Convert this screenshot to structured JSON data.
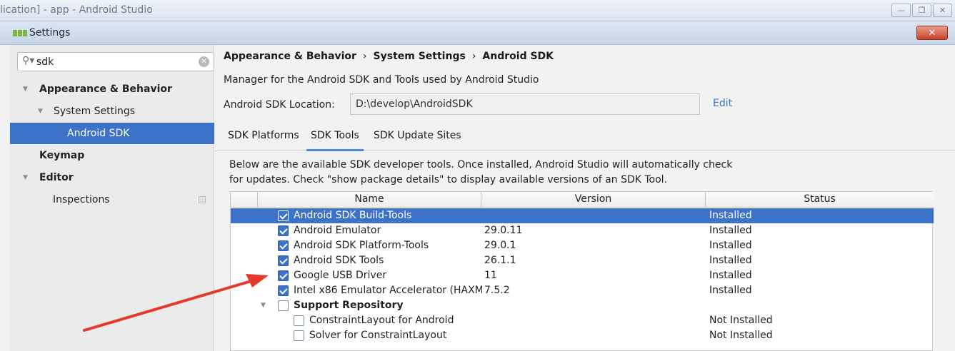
{
  "app": {
    "title": "lication] - app - Android Studio"
  },
  "dialog": {
    "title": "Settings"
  },
  "sidebar": {
    "search": {
      "value": "sdk"
    },
    "items": [
      {
        "label": "Appearance & Behavior"
      },
      {
        "label": "System Settings"
      },
      {
        "label": "Android SDK"
      },
      {
        "label": "Keymap"
      },
      {
        "label": "Editor"
      },
      {
        "label": "Inspections"
      }
    ]
  },
  "main": {
    "breadcrumb": [
      "Appearance & Behavior",
      "System Settings",
      "Android SDK"
    ],
    "breadcrumb_sep": "›",
    "description": "Manager for the Android SDK and Tools used by Android Studio",
    "sdk_location_label": "Android SDK Location:",
    "sdk_location_value": "D:\\develop\\AndroidSDK",
    "edit_label": "Edit",
    "tabs": [
      {
        "label": "SDK Platforms"
      },
      {
        "label": "SDK Tools"
      },
      {
        "label": "SDK Update Sites"
      }
    ],
    "hint_line1": "Below are the available SDK developer tools. Once installed, Android Studio will automatically check",
    "hint_line2": "for updates. Check \"show package details\" to display available versions of an SDK Tool.",
    "table": {
      "headers": {
        "name": "Name",
        "version": "Version",
        "status": "Status"
      },
      "rows": [
        {
          "name": "Android SDK Build-Tools",
          "version": "",
          "status": "Installed",
          "checked": true
        },
        {
          "name": "Android Emulator",
          "version": "29.0.11",
          "status": "Installed",
          "checked": true
        },
        {
          "name": "Android SDK Platform-Tools",
          "version": "29.0.1",
          "status": "Installed",
          "checked": true
        },
        {
          "name": "Android SDK Tools",
          "version": "26.1.1",
          "status": "Installed",
          "checked": true
        },
        {
          "name": "Google USB Driver",
          "version": "11",
          "status": "Installed",
          "checked": true
        },
        {
          "name": "Intel x86 Emulator Accelerator (HAXM",
          "version": "7.5.2",
          "status": "Installed",
          "checked": true
        },
        {
          "name": "Support Repository",
          "version": "",
          "status": "",
          "checked": false
        },
        {
          "name": "ConstraintLayout for Android",
          "version": "",
          "status": "Not Installed",
          "checked": false
        },
        {
          "name": "Solver for ConstraintLayout",
          "version": "",
          "status": "Not Installed",
          "checked": false
        }
      ]
    }
  },
  "colors": {
    "selection": "#3c73c8",
    "annotation": "#e8382c",
    "link": "#3a72c4"
  }
}
